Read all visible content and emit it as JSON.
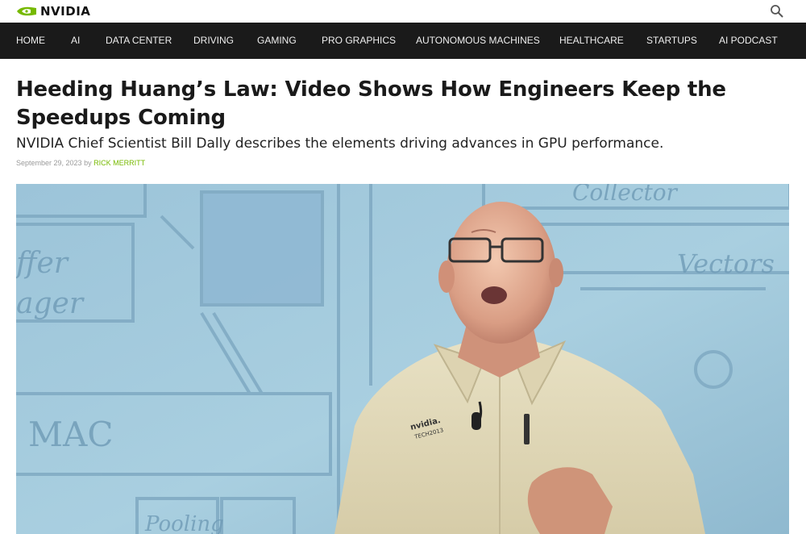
{
  "brand": {
    "logo_text": "NVIDIA",
    "accent": "#76b900"
  },
  "header": {
    "search_icon": "search-icon"
  },
  "nav": {
    "items": [
      {
        "label": "HOME"
      },
      {
        "label": "AI"
      },
      {
        "label": "DATA CENTER"
      },
      {
        "label": "DRIVING"
      },
      {
        "label": "GAMING"
      },
      {
        "label": "PRO GRAPHICS"
      },
      {
        "label": "AUTONOMOUS MACHINES"
      },
      {
        "label": "HEALTHCARE"
      },
      {
        "label": "STARTUPS"
      },
      {
        "label": "AI PODCAST"
      }
    ]
  },
  "article": {
    "title": "Heeding Huang’s Law: Video Shows How Engineers Keep the Speedups Coming",
    "subtitle": "NVIDIA Chief Scientist Bill Dally describes the elements driving advances in GPU performance.",
    "date": "September 29, 2023",
    "by": "by",
    "author": "RICK MERRITT"
  },
  "hero": {
    "slide_words": [
      "ffer",
      "ager",
      "MAC",
      "Vectors",
      "Pooling",
      "Collector"
    ],
    "shirt_logo": "nvidia.",
    "shirt_sub": "TECH2013"
  }
}
